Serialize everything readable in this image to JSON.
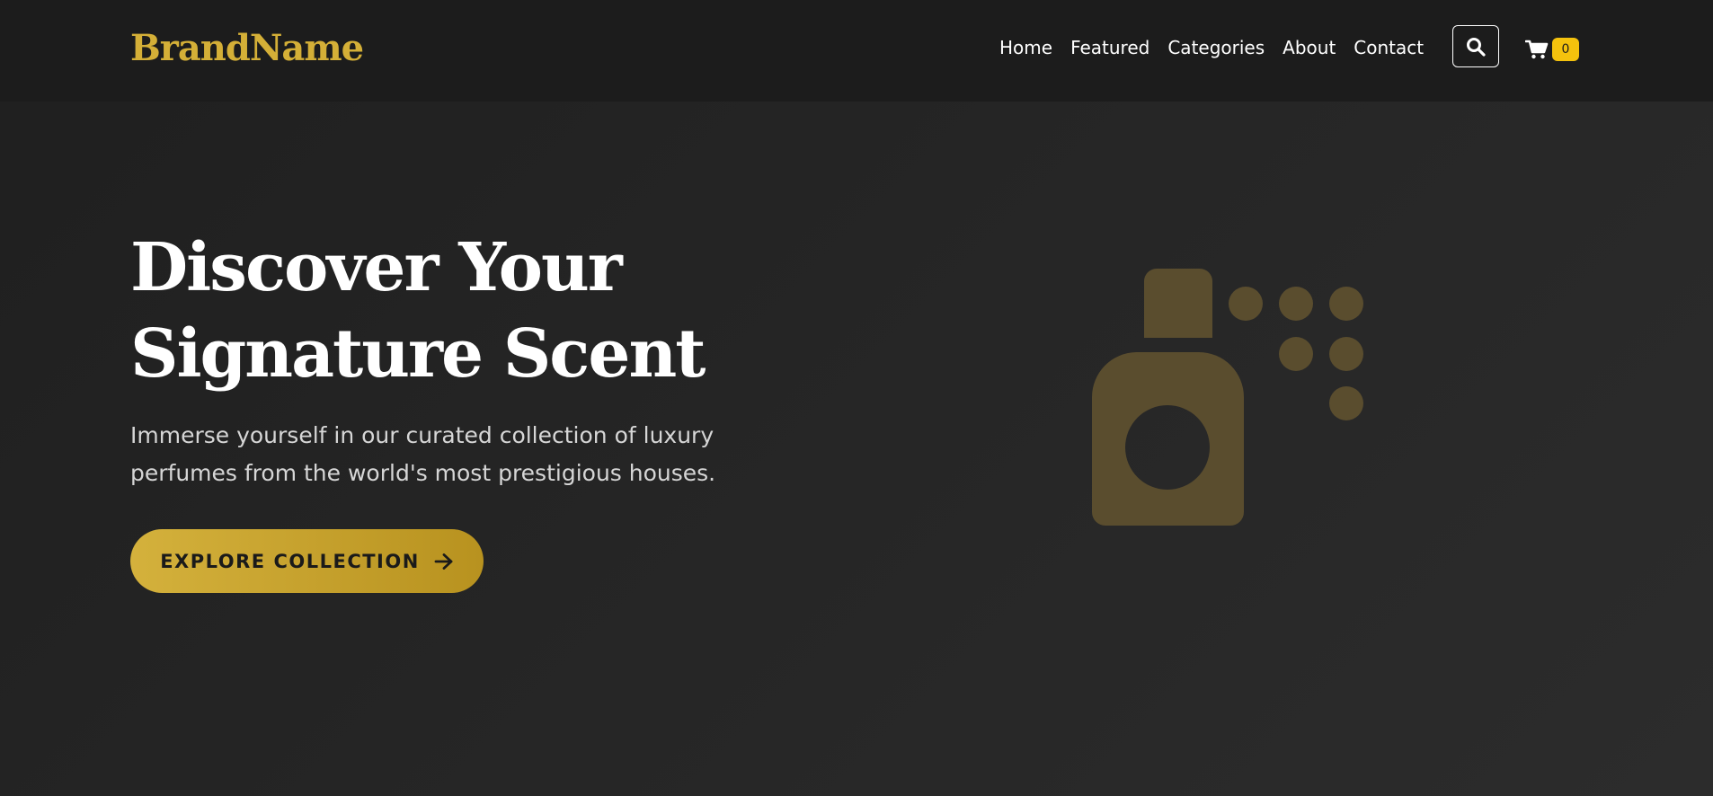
{
  "header": {
    "brand": "BrandName",
    "nav": [
      {
        "label": "Home"
      },
      {
        "label": "Featured"
      },
      {
        "label": "Categories"
      },
      {
        "label": "About"
      },
      {
        "label": "Contact"
      }
    ],
    "search_icon": "search-icon",
    "cart_icon": "cart-icon",
    "cart_count": "0"
  },
  "hero": {
    "title_line1": "Discover Your",
    "title_line2": "Signature Scent",
    "subtitle": "Immerse yourself in our curated collection of luxury perfumes from the world's most prestigious houses.",
    "cta_label": "EXPLORE COLLECTION",
    "cta_icon": "arrow-right-icon",
    "illustration_icon": "perfume-spray-icon"
  },
  "colors": {
    "background": "#232323",
    "header_bg": "#1c1c1c",
    "brand_gold": "#d4af37",
    "badge_yellow": "#f4c20d",
    "illustration": "#5a4d2e"
  }
}
